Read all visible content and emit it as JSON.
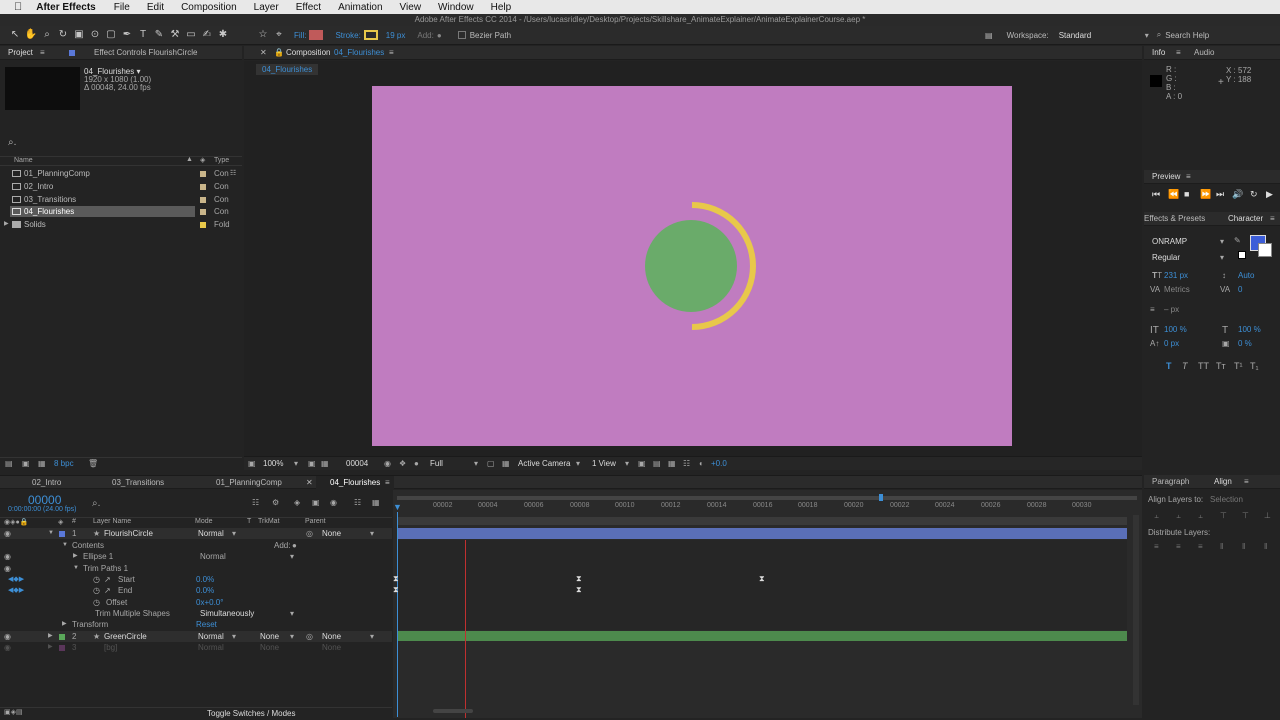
{
  "menubar": {
    "apple": "",
    "app": "After Effects",
    "items": [
      "File",
      "Edit",
      "Composition",
      "Layer",
      "Effect",
      "Animation",
      "View",
      "Window",
      "Help"
    ]
  },
  "titlebar": "Adobe After Effects CC 2014 - /Users/lucasridley/Desktop/Projects/Skillshare_AnimateExplainer/AnimateExplainerCourse.aep *",
  "toolbar": {
    "fill_label": "Fill:",
    "stroke_label": "Stroke:",
    "stroke_width": "19 px",
    "add_label": "Add:",
    "bezier_label": "Bezier Path",
    "workspace_label": "Workspace:",
    "workspace_value": "Standard",
    "search_placeholder": "Search Help",
    "fill_color": "#c05a5a",
    "stroke_color": "#e8c84a"
  },
  "project": {
    "tab": "Project",
    "effect_controls_tab": "Effect Controls FlourishCircle",
    "comp_name": "04_Flourishes ▾",
    "comp_size": "1920 x 1080 (1.00)",
    "comp_duration": "Δ 00048, 24.00 fps",
    "col_name": "Name",
    "col_type": "Type",
    "items": [
      {
        "name": "01_PlanningComp",
        "type": "Con",
        "selected": false
      },
      {
        "name": "02_Intro",
        "type": "Con",
        "selected": false
      },
      {
        "name": "03_Transitions",
        "type": "Con",
        "selected": false
      },
      {
        "name": "04_Flourishes",
        "type": "Con",
        "selected": true
      },
      {
        "name": "Solids",
        "type": "Fold",
        "selected": false
      }
    ],
    "bpc": "8 bpc"
  },
  "composition": {
    "tab_prefix": "Composition",
    "tab_name": "04_Flourishes",
    "subtab": "04_Flourishes",
    "bg_color": "#c07cc0",
    "circle_color": "#6aab6a",
    "arc_color": "#e8c84a",
    "footer": {
      "zoom": "100%",
      "timecode": "00004",
      "resolution": "Full",
      "camera": "Active Camera",
      "view": "1 View",
      "exposure": "+0.0"
    }
  },
  "info": {
    "tab_info": "Info",
    "tab_audio": "Audio",
    "r": "R :",
    "g": "G :",
    "b": "B :",
    "a": "A : 0",
    "x": "X : 572",
    "y": "Y : 188"
  },
  "preview": {
    "tab": "Preview"
  },
  "character": {
    "tab_effects": "Effects & Presets",
    "tab_character": "Character",
    "font": "ONRAMP",
    "style": "Regular",
    "size": "231 px",
    "leading": "Auto",
    "kerning": "Metrics",
    "tracking": "0",
    "stroke_width": "– px",
    "vert_scale": "100 %",
    "horiz_scale": "100 %",
    "baseline": "0 px",
    "tsume": "0 %",
    "fill_color": "#3d5ed8"
  },
  "paragraph": {
    "tab": "Paragraph",
    "align_tab": "Align",
    "align_to_label": "Align Layers to:",
    "align_to_value": "Selection",
    "distribute_label": "Distribute Layers:"
  },
  "timeline": {
    "tabs": [
      "02_Intro",
      "03_Transitions",
      "01_PlanningComp",
      "04_Flourishes"
    ],
    "timecode": "00000",
    "timecode_sub": "0:00:00:00 (24.00 fps)",
    "columns": {
      "num": "#",
      "layer_name": "Layer Name",
      "mode": "Mode",
      "t": "T",
      "trkmat": "TrkMat",
      "parent": "Parent"
    },
    "ruler": [
      "00002",
      "00004",
      "00006",
      "00008",
      "00010",
      "00012",
      "00014",
      "00016",
      "00018",
      "00020",
      "00022",
      "00024",
      "00026",
      "00028",
      "00030"
    ],
    "rows": {
      "layer1_num": "1",
      "layer1_name": "FlourishCircle",
      "layer1_mode": "Normal",
      "layer1_parent": "None",
      "contents": "Contents",
      "add": "Add:",
      "ellipse": "Ellipse 1",
      "ellipse_mode": "Normal",
      "trim": "Trim Paths 1",
      "start_label": "Start",
      "start_value": "0.0%",
      "end_label": "End",
      "end_value": "0.0%",
      "offset_label": "Offset",
      "offset_value": "0x+0.0°",
      "trim_multi_label": "Trim Multiple Shapes",
      "trim_multi_value": "Simultaneously",
      "transform": "Transform",
      "reset": "Reset",
      "layer2_num": "2",
      "layer2_name": "GreenCircle",
      "layer2_mode": "Normal",
      "layer2_trkmat": "None",
      "layer2_parent": "None",
      "layer3_num": "3",
      "layer3_name": "[bg]",
      "layer3_mode": "Normal",
      "layer3_trkmat": "None",
      "layer3_parent": "None"
    },
    "toggle": "Toggle Switches / Modes",
    "layer1_bar_color": "#5a6fb8",
    "layer2_bar_color": "#4d8a4d"
  }
}
